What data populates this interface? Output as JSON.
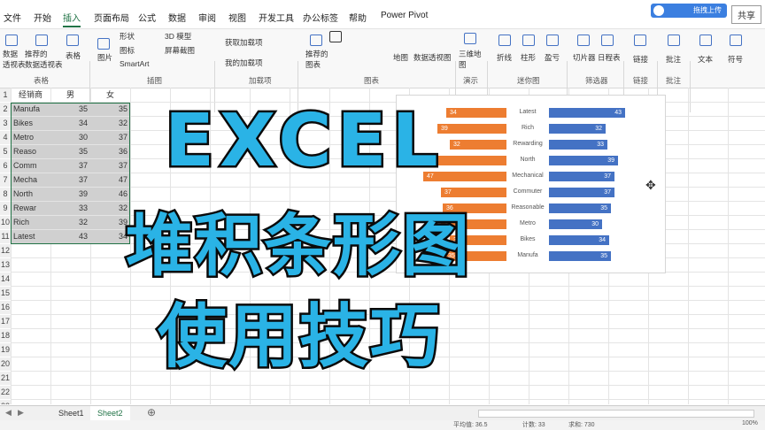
{
  "ribbon_tabs": [
    "文件",
    "开始",
    "插入",
    "页面布局",
    "公式",
    "数据",
    "审阅",
    "视图",
    "开发工具",
    "办公标签",
    "帮助",
    "Power Pivot"
  ],
  "active_tab": "插入",
  "share_label": "共享",
  "upload_label": "拖拽上传",
  "ribbon_buttons": {
    "pivot": "数据\n透视表",
    "recommended_pivot": "推荐的\n数据透视表",
    "table": "表格",
    "picture": "图片",
    "shape": "形状",
    "icon": "图标",
    "smartart": "SmartArt",
    "model3d": "3D 模型",
    "screenshot": "屏幕截图",
    "get_addins": "获取加载项",
    "my_addins": "我的加载项",
    "recommended_chart": "推荐的\n图表",
    "map": "地图",
    "pivot_chart": "数据透视图",
    "map3d": "三维地\n图",
    "line": "折线",
    "column": "柱形",
    "winloss": "盈亏",
    "slicer": "切片器",
    "timeline": "日程表",
    "link": "链接",
    "comment": "批注",
    "text": "文本",
    "symbol": "符号"
  },
  "ribbon_groups": {
    "tables": "表格",
    "illustrations": "插图",
    "addins": "加载项",
    "charts": "图表",
    "tours": "演示",
    "sparklines": "迷你图",
    "filters": "筛选器",
    "links": "链接",
    "comments": "批注"
  },
  "sheet": {
    "headers": [
      "经销商",
      "男",
      "女"
    ],
    "rows": [
      {
        "name": "Manufa",
        "male": 35,
        "female": 35
      },
      {
        "name": "Bikes",
        "male": 34,
        "female": 32
      },
      {
        "name": "Metro",
        "male": 30,
        "female": 37
      },
      {
        "name": "Reaso",
        "male": 35,
        "female": 36
      },
      {
        "name": "Comm",
        "male": 37,
        "female": 37
      },
      {
        "name": "Mecha",
        "male": 37,
        "female": 47
      },
      {
        "name": "North",
        "male": 39,
        "female": 46
      },
      {
        "name": "Rewar",
        "male": 33,
        "female": 32
      },
      {
        "name": "Rich",
        "male": 32,
        "female": 39
      },
      {
        "name": "Latest",
        "male": 43,
        "female": 34
      }
    ],
    "row_numbers": [
      "1",
      "2",
      "3",
      "4",
      "5",
      "6",
      "7",
      "8",
      "9",
      "10",
      "11",
      "12",
      "13",
      "14",
      "15",
      "16",
      "17",
      "18",
      "19",
      "20",
      "21",
      "22",
      "23"
    ]
  },
  "chart_data": {
    "type": "bar",
    "categories": [
      "Latest",
      "Rich",
      "Rewarding",
      "North",
      "Mechanical",
      "Commuter",
      "Reasonable",
      "Metro",
      "Bikes",
      "Manufa"
    ],
    "series": [
      {
        "values": [
          34,
          39,
          32,
          46,
          47,
          37,
          36,
          37,
          32,
          35
        ],
        "color": "#ed7d31"
      },
      {
        "values": [
          43,
          32,
          33,
          39,
          37,
          37,
          35,
          30,
          34,
          35
        ],
        "color": "#4472c4"
      }
    ]
  },
  "overlay": {
    "line1": "EXCEL",
    "line2": "堆积条形图",
    "line3": "使用技巧"
  },
  "sheet_tabs": [
    "Sheet1",
    "Sheet2"
  ],
  "active_sheet": "Sheet2",
  "status": {
    "avg": "平均值: 36.5",
    "count": "计数: 33",
    "sum": "求和: 730",
    "zoom": "100%"
  }
}
